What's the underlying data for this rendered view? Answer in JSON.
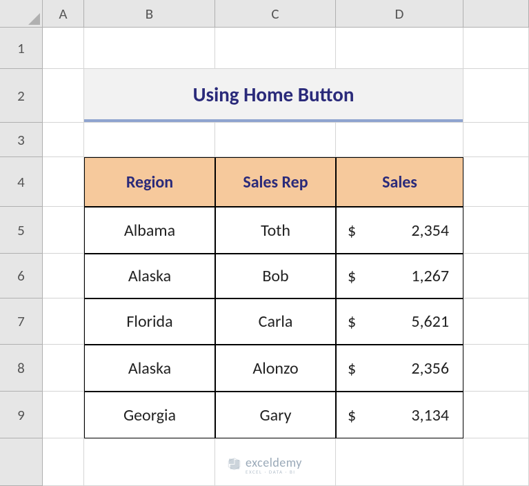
{
  "columns": [
    "A",
    "B",
    "C",
    "D"
  ],
  "rows": [
    "1",
    "2",
    "3",
    "4",
    "5",
    "6",
    "7",
    "8",
    "9"
  ],
  "title": "Using Home Button",
  "table": {
    "headers": [
      "Region",
      "Sales Rep",
      "Sales"
    ],
    "data": [
      {
        "region": "Albama",
        "rep": "Toth",
        "currency": "$",
        "sales": "2,354"
      },
      {
        "region": "Alaska",
        "rep": "Bob",
        "currency": "$",
        "sales": "1,267"
      },
      {
        "region": "Florida",
        "rep": "Carla",
        "currency": "$",
        "sales": "5,621"
      },
      {
        "region": "Alaska",
        "rep": "Alonzo",
        "currency": "$",
        "sales": "2,356"
      },
      {
        "region": "Georgia",
        "rep": "Gary",
        "currency": "$",
        "sales": "3,134"
      }
    ]
  },
  "watermark": {
    "main": "exceldemy",
    "sub": "EXCEL · DATA · BI"
  }
}
